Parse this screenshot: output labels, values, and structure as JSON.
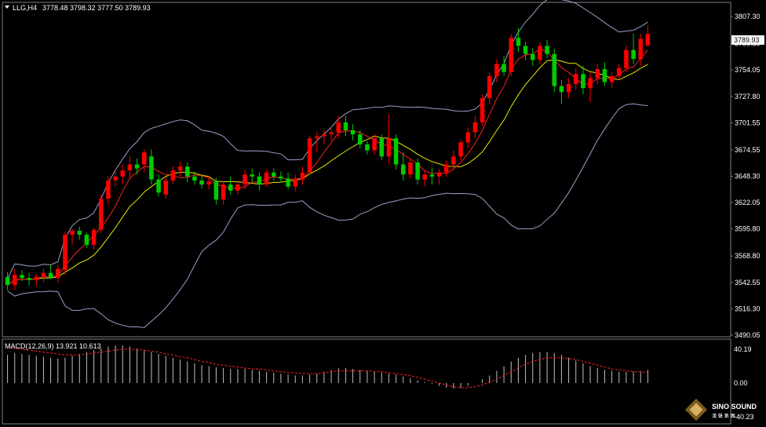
{
  "header": {
    "symbol": "LLG,H4",
    "ohlc": "3778.48 3798.32 3777.50 3789.93"
  },
  "price_axis": {
    "ticks": [
      "3807.30",
      "3780.30",
      "3754.05",
      "3727.80",
      "3701.55",
      "3674.55",
      "3648.30",
      "3622.05",
      "3595.80",
      "3568.80",
      "3542.55",
      "3516.30",
      "3490.05"
    ],
    "current_price": "3789.93"
  },
  "macd_panel": {
    "label": "MACD(12,26,9) 13.921 10.613",
    "ticks": [
      "40.19",
      "0.00",
      "-40.23"
    ]
  },
  "logo": {
    "name": "SINO SOUND",
    "sub": "漢 聲 集 團"
  },
  "colors": {
    "bull": "#00cc00",
    "bear": "#ff0000",
    "band": "#9aa0c8",
    "ma_fast": "#ff2020",
    "ma_slow": "#e8e800",
    "histogram": "#c0c0c0",
    "signal": "#ff2020"
  },
  "chart_data": [
    {
      "type": "candlestick",
      "title": "LLG,H4",
      "ylim": [
        3490.05,
        3820
      ],
      "grid": false,
      "indicators": [
        "Bollinger Bands",
        "Moving Average (fast)",
        "Moving Average (slow)"
      ],
      "candles": [
        [
          3548,
          3553,
          3535,
          3540
        ],
        [
          3540,
          3556,
          3535,
          3550
        ],
        [
          3550,
          3555,
          3544,
          3547
        ],
        [
          3547,
          3552,
          3540,
          3545
        ],
        [
          3545,
          3551,
          3539,
          3548
        ],
        [
          3548,
          3556,
          3543,
          3552
        ],
        [
          3552,
          3560,
          3546,
          3547
        ],
        [
          3547,
          3560,
          3542,
          3556
        ],
        [
          3555,
          3593,
          3550,
          3590
        ],
        [
          3590,
          3596,
          3580,
          3594
        ],
        [
          3594,
          3598,
          3585,
          3590
        ],
        [
          3590,
          3592,
          3577,
          3580
        ],
        [
          3580,
          3597,
          3575,
          3595
        ],
        [
          3595,
          3630,
          3592,
          3626
        ],
        [
          3626,
          3648,
          3620,
          3644
        ],
        [
          3644,
          3655,
          3638,
          3648
        ],
        [
          3648,
          3660,
          3640,
          3654
        ],
        [
          3654,
          3668,
          3645,
          3660
        ],
        [
          3660,
          3666,
          3650,
          3656
        ],
        [
          3660,
          3675,
          3652,
          3672
        ],
        [
          3668,
          3675,
          3640,
          3645
        ],
        [
          3645,
          3650,
          3628,
          3632
        ],
        [
          3630,
          3648,
          3626,
          3644
        ],
        [
          3644,
          3658,
          3640,
          3654
        ],
        [
          3654,
          3663,
          3648,
          3658
        ],
        [
          3658,
          3662,
          3642,
          3648
        ],
        [
          3648,
          3653,
          3640,
          3644
        ],
        [
          3644,
          3650,
          3636,
          3640
        ],
        [
          3640,
          3648,
          3635,
          3643
        ],
        [
          3643,
          3647,
          3620,
          3625
        ],
        [
          3625,
          3644,
          3620,
          3640
        ],
        [
          3640,
          3648,
          3630,
          3634
        ],
        [
          3634,
          3644,
          3630,
          3640
        ],
        [
          3640,
          3655,
          3635,
          3650
        ],
        [
          3650,
          3656,
          3643,
          3648
        ],
        [
          3648,
          3652,
          3634,
          3640
        ],
        [
          3640,
          3655,
          3638,
          3652
        ],
        [
          3652,
          3656,
          3644,
          3648
        ],
        [
          3648,
          3653,
          3642,
          3646
        ],
        [
          3646,
          3652,
          3635,
          3638
        ],
        [
          3638,
          3650,
          3633,
          3645
        ],
        [
          3645,
          3658,
          3640,
          3652
        ],
        [
          3652,
          3689,
          3650,
          3686
        ],
        [
          3686,
          3692,
          3672,
          3688
        ],
        [
          3688,
          3694,
          3680,
          3690
        ],
        [
          3690,
          3698,
          3684,
          3692
        ],
        [
          3692,
          3708,
          3686,
          3702
        ],
        [
          3702,
          3708,
          3688,
          3694
        ],
        [
          3694,
          3700,
          3684,
          3690
        ],
        [
          3690,
          3694,
          3676,
          3680
        ],
        [
          3680,
          3683,
          3670,
          3674
        ],
        [
          3674,
          3690,
          3670,
          3686
        ],
        [
          3686,
          3690,
          3664,
          3668
        ],
        [
          3668,
          3710,
          3660,
          3686
        ],
        [
          3686,
          3690,
          3655,
          3660
        ],
        [
          3660,
          3672,
          3644,
          3650
        ],
        [
          3650,
          3666,
          3646,
          3662
        ],
        [
          3662,
          3666,
          3640,
          3645
        ],
        [
          3645,
          3655,
          3638,
          3650
        ],
        [
          3650,
          3657,
          3640,
          3648
        ],
        [
          3648,
          3656,
          3640,
          3652
        ],
        [
          3652,
          3664,
          3648,
          3660
        ],
        [
          3660,
          3674,
          3654,
          3668
        ],
        [
          3668,
          3685,
          3664,
          3682
        ],
        [
          3682,
          3696,
          3676,
          3692
        ],
        [
          3692,
          3708,
          3686,
          3702
        ],
        [
          3702,
          3730,
          3698,
          3726
        ],
        [
          3726,
          3752,
          3720,
          3748
        ],
        [
          3748,
          3765,
          3742,
          3760
        ],
        [
          3760,
          3768,
          3748,
          3752
        ],
        [
          3752,
          3790,
          3748,
          3786
        ],
        [
          3786,
          3796,
          3772,
          3778
        ],
        [
          3778,
          3782,
          3764,
          3770
        ],
        [
          3770,
          3776,
          3758,
          3764
        ],
        [
          3764,
          3782,
          3760,
          3778
        ],
        [
          3778,
          3784,
          3766,
          3770
        ],
        [
          3770,
          3775,
          3732,
          3738
        ],
        [
          3738,
          3744,
          3720,
          3732
        ],
        [
          3732,
          3746,
          3726,
          3740
        ],
        [
          3740,
          3756,
          3734,
          3750
        ],
        [
          3750,
          3758,
          3730,
          3736
        ],
        [
          3736,
          3752,
          3722,
          3746
        ],
        [
          3746,
          3760,
          3740,
          3755
        ],
        [
          3755,
          3762,
          3738,
          3742
        ],
        [
          3742,
          3752,
          3736,
          3748
        ],
        [
          3748,
          3760,
          3744,
          3756
        ],
        [
          3756,
          3778,
          3752,
          3774
        ],
        [
          3774,
          3790,
          3760,
          3765
        ],
        [
          3765,
          3790,
          3758,
          3785
        ],
        [
          3778.48,
          3798.32,
          3777.5,
          3789.93
        ]
      ]
    },
    {
      "type": "bar",
      "title": "MACD(12,26,9) 13.921 10.613",
      "series": [
        {
          "name": "MACD",
          "values": [
            30,
            32,
            31,
            30,
            29,
            28,
            27,
            26,
            27,
            29,
            31,
            33,
            35,
            37,
            39,
            40,
            40,
            39,
            37,
            35,
            33,
            31,
            29,
            27,
            25,
            23,
            21,
            19,
            18,
            17,
            16,
            15,
            15,
            15,
            14,
            13,
            12,
            11,
            10,
            9,
            8,
            8,
            9,
            10,
            12,
            14,
            16,
            16,
            15,
            14,
            13,
            12,
            11,
            10,
            9,
            7,
            5,
            3,
            1,
            -1,
            -3,
            -5,
            -6,
            -5,
            -3,
            0,
            4,
            8,
            13,
            18,
            23,
            27,
            30,
            32,
            33,
            33,
            32,
            30,
            27,
            24,
            21,
            18,
            16,
            14,
            13,
            12,
            12,
            12,
            13,
            14
          ]
        },
        {
          "name": "Signal",
          "values": [
            38,
            37,
            36,
            35,
            34,
            33,
            32,
            31,
            30,
            30,
            30,
            31,
            32,
            33,
            34,
            35,
            36,
            36,
            36,
            35,
            34,
            33,
            31,
            30,
            28,
            27,
            25,
            23,
            22,
            20,
            19,
            18,
            17,
            16,
            15,
            15,
            14,
            13,
            12,
            11,
            11,
            10,
            10,
            10,
            11,
            12,
            13,
            13,
            13,
            13,
            13,
            12,
            12,
            11,
            10,
            9,
            8,
            6,
            4,
            2,
            0,
            -2,
            -4,
            -5,
            -5,
            -4,
            -2,
            1,
            4,
            8,
            12,
            16,
            20,
            23,
            25,
            27,
            27,
            27,
            26,
            25,
            23,
            21,
            19,
            17,
            15,
            14,
            13,
            12,
            12,
            11
          ]
        }
      ],
      "ylim": [
        -40.23,
        40.19
      ]
    }
  ]
}
